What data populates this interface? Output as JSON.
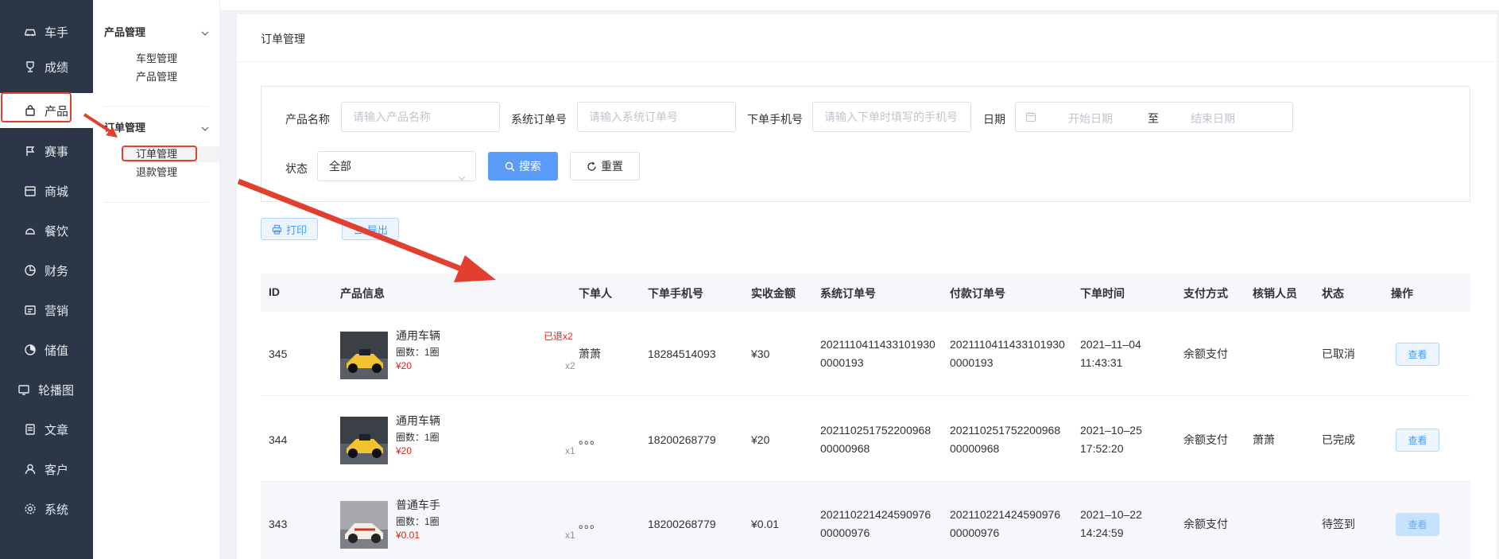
{
  "nav": {
    "items": [
      {
        "label": "车手",
        "icon": "car-icon"
      },
      {
        "label": "成绩",
        "icon": "trophy-icon"
      },
      {
        "label": "产品",
        "icon": "bag-icon"
      },
      {
        "label": "赛事",
        "icon": "flag-icon"
      },
      {
        "label": "商城",
        "icon": "store-icon"
      },
      {
        "label": "餐饮",
        "icon": "dish-icon"
      },
      {
        "label": "财务",
        "icon": "pie-icon"
      },
      {
        "label": "营销",
        "icon": "marketing-icon"
      },
      {
        "label": "储值",
        "icon": "wallet-icon"
      },
      {
        "label": "轮播图",
        "icon": "carousel-icon"
      },
      {
        "label": "文章",
        "icon": "article-icon"
      },
      {
        "label": "客户",
        "icon": "user-icon"
      },
      {
        "label": "系统",
        "icon": "gear-icon"
      }
    ],
    "active_index": 2
  },
  "submenu": {
    "groups": [
      {
        "title": "产品管理",
        "items": [
          "车型管理",
          "产品管理"
        ]
      },
      {
        "title": "订单管理",
        "items": [
          "订单管理",
          "退款管理"
        ]
      }
    ],
    "active_item": "订单管理"
  },
  "page": {
    "title": "订单管理"
  },
  "filter": {
    "product_name_label": "产品名称",
    "product_name_placeholder": "请输入产品名称",
    "order_no_label": "系统订单号",
    "order_no_placeholder": "请输入系统订单号",
    "phone_label": "下单手机号",
    "phone_placeholder": "请输入下单时填写的手机号",
    "date_label": "日期",
    "date_start": "开始日期",
    "date_sep": "至",
    "date_end": "结束日期",
    "status_label": "状态",
    "status_value": "全部",
    "search_label": "搜索",
    "reset_label": "重置"
  },
  "toolbar": {
    "print_label": "打印",
    "export_label": "导出"
  },
  "table": {
    "headers": [
      "ID",
      "产品信息",
      "下单人",
      "下单手机号",
      "实收金额",
      "系统订单号",
      "付款订单号",
      "下单时间",
      "支付方式",
      "核销人员",
      "状态",
      "操作"
    ],
    "rows": [
      {
        "id": "345",
        "product": "通用车辆",
        "laps": "圈数：1圈",
        "price": "¥20",
        "tag": "已退x2",
        "qty": "x2",
        "buyer": "萧萧",
        "phone": "18284514093",
        "amount": "¥30",
        "sys_order_1": "2021110411433101930",
        "sys_order_2": "0000193",
        "pay_order_1": "2021110411433101930",
        "pay_order_2": "0000193",
        "date": "2021–11–04",
        "time": "11:43:31",
        "pay_method": "余额支付",
        "verifier": "",
        "status": "已取消",
        "action": "查看"
      },
      {
        "id": "344",
        "product": "通用车辆",
        "laps": "圈数：1圈",
        "price": "¥20",
        "tag": "",
        "qty": "x1",
        "buyer": "。。。",
        "phone": "18200268779",
        "amount": "¥20",
        "sys_order_1": "202110251752200968",
        "sys_order_2": "00000968",
        "pay_order_1": "202110251752200968",
        "pay_order_2": "00000968",
        "date": "2021–10–25",
        "time": "17:52:20",
        "pay_method": "余额支付",
        "verifier": "萧萧",
        "status": "已完成",
        "action": "查看"
      },
      {
        "id": "343",
        "product": "普通车手",
        "laps": "圈数：1圈",
        "price": "¥0.01",
        "tag": "",
        "qty": "x1",
        "buyer": "。。。",
        "phone": "18200268779",
        "amount": "¥0.01",
        "sys_order_1": "202110221424590976",
        "sys_order_2": "00000976",
        "pay_order_1": "202110221424590976",
        "pay_order_2": "00000976",
        "date": "2021–10–22",
        "time": "14:24:59",
        "pay_method": "余额支付",
        "verifier": "",
        "status": "待签到",
        "action": "查看"
      }
    ]
  },
  "colors": {
    "nav_bg": "#2b3746",
    "primary": "#5a9cf8",
    "price_red": "#e2231a",
    "annotation_red": "#e2402f"
  }
}
